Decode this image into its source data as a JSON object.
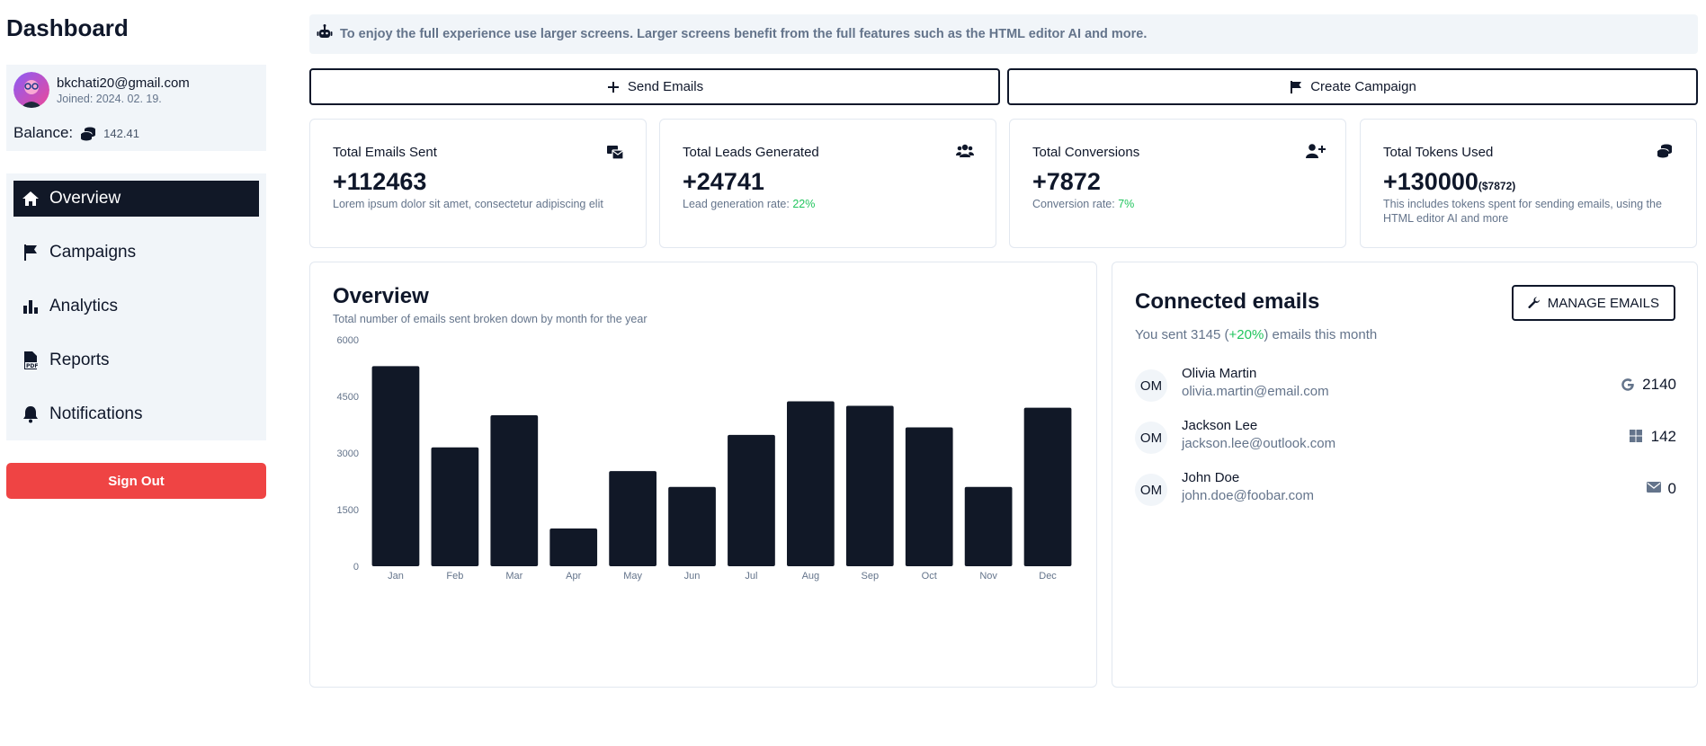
{
  "sidebar": {
    "title": "Dashboard",
    "profile": {
      "email": "bkchati20@gmail.com",
      "joined": "Joined: 2024. 02. 19.",
      "balance_label": "Balance:",
      "balance_value": "142.41"
    },
    "nav": [
      {
        "label": "Overview",
        "icon": "home-icon",
        "active": true
      },
      {
        "label": "Campaigns",
        "icon": "flag-icon",
        "active": false
      },
      {
        "label": "Analytics",
        "icon": "bar-chart-icon",
        "active": false
      },
      {
        "label": "Reports",
        "icon": "pdf-file-icon",
        "active": false
      },
      {
        "label": "Notifications",
        "icon": "bell-icon",
        "active": false
      }
    ],
    "signout": "Sign Out"
  },
  "banner": {
    "text": "To enjoy the full experience use larger screens. Larger screens benefit from the full features such as the HTML editor AI and more."
  },
  "actions": {
    "send_emails": "Send Emails",
    "create_campaign": "Create Campaign"
  },
  "stats": [
    {
      "title": "Total Emails Sent",
      "value": "+112463",
      "desc": "Lorem ipsum dolor sit amet, consectetur adipiscing elit",
      "icon": "mail-bulk-icon"
    },
    {
      "title": "Total Leads Generated",
      "value": "+24741",
      "desc_prefix": "Lead generation rate: ",
      "desc_highlight": "22%",
      "icon": "users-icon"
    },
    {
      "title": "Total Conversions",
      "value": "+7872",
      "desc_prefix": "Conversion rate: ",
      "desc_highlight": "7%",
      "icon": "user-plus-icon"
    },
    {
      "title": "Total Tokens Used",
      "value": "+130000",
      "value_sub": "($7872)",
      "desc": "This includes tokens spent for sending emails, using the HTML editor AI and more",
      "icon": "coins-icon"
    }
  ],
  "overview": {
    "title": "Overview",
    "subtitle": "Total number of emails sent broken down by month for the year"
  },
  "chart_data": {
    "type": "bar",
    "categories": [
      "Jan",
      "Feb",
      "Mar",
      "Apr",
      "May",
      "Jun",
      "Jul",
      "Aug",
      "Sep",
      "Oct",
      "Nov",
      "Dec"
    ],
    "values": [
      5300,
      3150,
      4000,
      1000,
      2520,
      2100,
      3480,
      4370,
      4250,
      3680,
      2100,
      4200
    ],
    "yticks": [
      0,
      1500,
      3000,
      4500,
      6000
    ],
    "ylim": [
      0,
      6000
    ],
    "color": "#111827",
    "grid": false
  },
  "connected": {
    "title": "Connected emails",
    "manage_label": "MANAGE EMAILS",
    "sub_prefix": "You sent 3145 (",
    "sub_highlight": "+20%",
    "sub_suffix": ") emails this month",
    "accounts": [
      {
        "initials": "OM",
        "name": "Olivia Martin",
        "email": "olivia.martin@email.com",
        "count": "2140",
        "icon": "google-icon"
      },
      {
        "initials": "OM",
        "name": "Jackson Lee",
        "email": "jackson.lee@outlook.com",
        "count": "142",
        "icon": "windows-icon"
      },
      {
        "initials": "OM",
        "name": "John Doe",
        "email": "john.doe@foobar.com",
        "count": "0",
        "icon": "envelope-icon"
      }
    ]
  }
}
